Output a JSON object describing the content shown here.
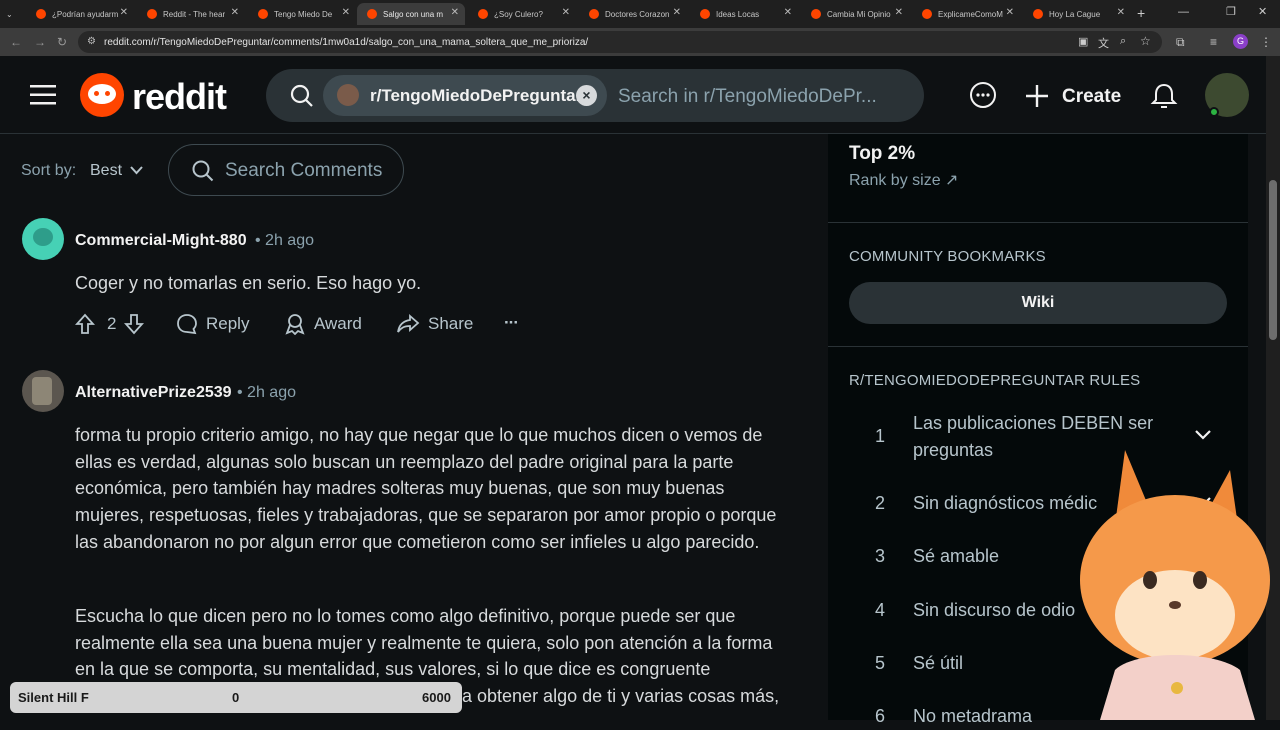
{
  "browser": {
    "tabs": [
      {
        "label": "¿Podrían ayudarm"
      },
      {
        "label": "Reddit - The hear"
      },
      {
        "label": "Tengo Miedo De"
      },
      {
        "label": "Salgo con una m"
      },
      {
        "label": "¿Soy Culero?"
      },
      {
        "label": "Doctores Corazon"
      },
      {
        "label": "Ideas Locas"
      },
      {
        "label": "Cambia Mi Opinio"
      },
      {
        "label": "ExplicameComoM"
      },
      {
        "label": "Hoy La Cague"
      }
    ],
    "url": "reddit.com/r/TengoMiedoDePreguntar/comments/1mw0a1d/salgo_con_una_mama_soltera_que_me_prioriza/",
    "profile_letter": "G"
  },
  "header": {
    "logo_text": "reddit",
    "search_chip": "r/TengoMiedoDePreguntar",
    "search_placeholder": "Search in r/TengoMiedoDePr...",
    "create_label": "Create"
  },
  "comments_toolbar": {
    "sort_label": "Sort by:",
    "sort_value": "Best",
    "search_placeholder": "Search Comments"
  },
  "comments": [
    {
      "user": "Commercial-Might-880",
      "time": "• 2h ago",
      "body": "Coger y no tomarlas en serio. Eso hago yo.",
      "votes": "2",
      "reply": "Reply",
      "award": "Award",
      "share": "Share",
      "more": "···"
    },
    {
      "user": "AlternativePrize2539",
      "time": "• 2h ago",
      "paragraphs": [
        "forma tu propio criterio amigo, no hay que negar que lo que muchos dicen o vemos de ellas es verdad, algunas solo buscan un reemplazo del padre original para la parte económica, pero también hay madres solteras muy buenas, que son muy buenas mujeres, respetuosas, fieles y trabajadoras, que se separaron por amor propio o porque las abandonaron no por algun error que cometieron como ser infieles u algo parecido.",
        "Escucha lo que dicen pero no lo tomes como algo definitivo, porque puede ser que realmente ella sea una buena mujer y realmente te quiera, solo pon atención a la forma en la que se comporta, su mentalidad, sus valores, si lo que dice es congruente",
        "a obtener algo de ti y varias cosas más,"
      ]
    }
  ],
  "sidebar": {
    "rank_title": "Top 2%",
    "rank_sub": "Rank by size",
    "bookmarks_heading": "COMMUNITY BOOKMARKS",
    "wiki_label": "Wiki",
    "rules_heading": "R/TENGOMIEDODEPREGUNTAR RULES",
    "rules": [
      {
        "num": "1",
        "text": "Las publicaciones DEBEN ser preguntas"
      },
      {
        "num": "2",
        "text": "Sin diagnósticos médic"
      },
      {
        "num": "3",
        "text": "Sé amable"
      },
      {
        "num": "4",
        "text": "Sin discurso de odio"
      },
      {
        "num": "5",
        "text": "Sé útil"
      },
      {
        "num": "6",
        "text": "No metadrama"
      }
    ]
  },
  "overlay_game": {
    "title": "Silent Hill F",
    "value_a": "0",
    "value_b": "6000"
  },
  "colors": {
    "brand": "#ff4500",
    "background": "#0e1113",
    "sidebar_bg": "#04090a"
  }
}
